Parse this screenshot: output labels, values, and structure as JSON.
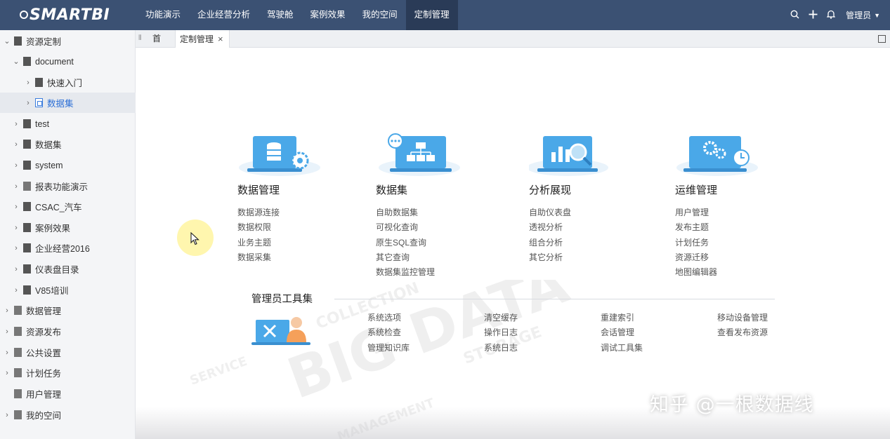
{
  "app": {
    "logo_text": "SMARTBI"
  },
  "nav": [
    {
      "label": "功能演示",
      "active": false
    },
    {
      "label": "企业经营分析",
      "active": false
    },
    {
      "label": "驾驶舱",
      "active": false
    },
    {
      "label": "案例效果",
      "active": false
    },
    {
      "label": "我的空间",
      "active": false
    },
    {
      "label": "定制管理",
      "active": true
    }
  ],
  "topright": {
    "user_label": "管理员"
  },
  "sidebar": {
    "items": [
      {
        "label": "资源定制",
        "expanded": true,
        "selected": false
      },
      {
        "label": "document",
        "expanded": true,
        "selected": false
      },
      {
        "label": "快速入门",
        "expanded": false,
        "selected": false
      },
      {
        "label": "数据集",
        "expanded": false,
        "selected": true
      },
      {
        "label": "test",
        "expanded": false,
        "selected": false
      },
      {
        "label": "数据集",
        "expanded": false,
        "selected": false
      },
      {
        "label": "system",
        "expanded": false,
        "selected": false
      },
      {
        "label": "报表功能演示",
        "expanded": false,
        "selected": false
      },
      {
        "label": "CSAC_汽车",
        "expanded": false,
        "selected": false
      },
      {
        "label": "案例效果",
        "expanded": false,
        "selected": false
      },
      {
        "label": "企业经营2016",
        "expanded": false,
        "selected": false
      },
      {
        "label": "仪表盘目录",
        "expanded": false,
        "selected": false
      },
      {
        "label": "V85培训",
        "expanded": false,
        "selected": false
      },
      {
        "label": "数据管理",
        "expanded": false,
        "selected": false
      },
      {
        "label": "资源发布",
        "expanded": false,
        "selected": false
      },
      {
        "label": "公共设置",
        "expanded": false,
        "selected": false
      },
      {
        "label": "计划任务",
        "expanded": false,
        "selected": false
      },
      {
        "label": "用户管理",
        "expanded": false,
        "selected": false
      },
      {
        "label": "我的空间",
        "expanded": false,
        "selected": false
      }
    ]
  },
  "tabs": {
    "home": "首页",
    "active": "定制管理",
    "close_symbol": "×"
  },
  "sections": [
    {
      "title": "数据管理",
      "icon": "database-gear-icon",
      "links": [
        "数据源连接",
        "数据权限",
        "业务主题",
        "数据采集"
      ]
    },
    {
      "title": "数据集",
      "icon": "dataset-tree-icon",
      "links": [
        "自助数据集",
        "可视化查询",
        "原生SQL查询",
        "其它查询",
        "数据集监控管理"
      ]
    },
    {
      "title": "分析展现",
      "icon": "chart-magnifier-icon",
      "links": [
        "自助仪表盘",
        "透视分析",
        "组合分析",
        "其它分析"
      ]
    },
    {
      "title": "运维管理",
      "icon": "gears-clock-icon",
      "links": [
        "用户管理",
        "发布主题",
        "计划任务",
        "资源迁移",
        "地图编辑器"
      ]
    }
  ],
  "admin_tools": {
    "title": "管理员工具集",
    "columns": [
      [
        "系统选项",
        "系统检查",
        "管理知识库"
      ],
      [
        "清空缓存",
        "操作日志",
        "系统日志"
      ],
      [
        "重建索引",
        "会话管理",
        "调试工具集"
      ],
      [
        "移动设备管理",
        "查看发布资源"
      ]
    ]
  },
  "watermark_text": "知乎 @一根数据线",
  "colors": {
    "topbar": "#3b5173",
    "active_nav": "#2a3b57",
    "illustration_blue": "#4aa8e8",
    "selected_link": "#2c6fd6"
  }
}
